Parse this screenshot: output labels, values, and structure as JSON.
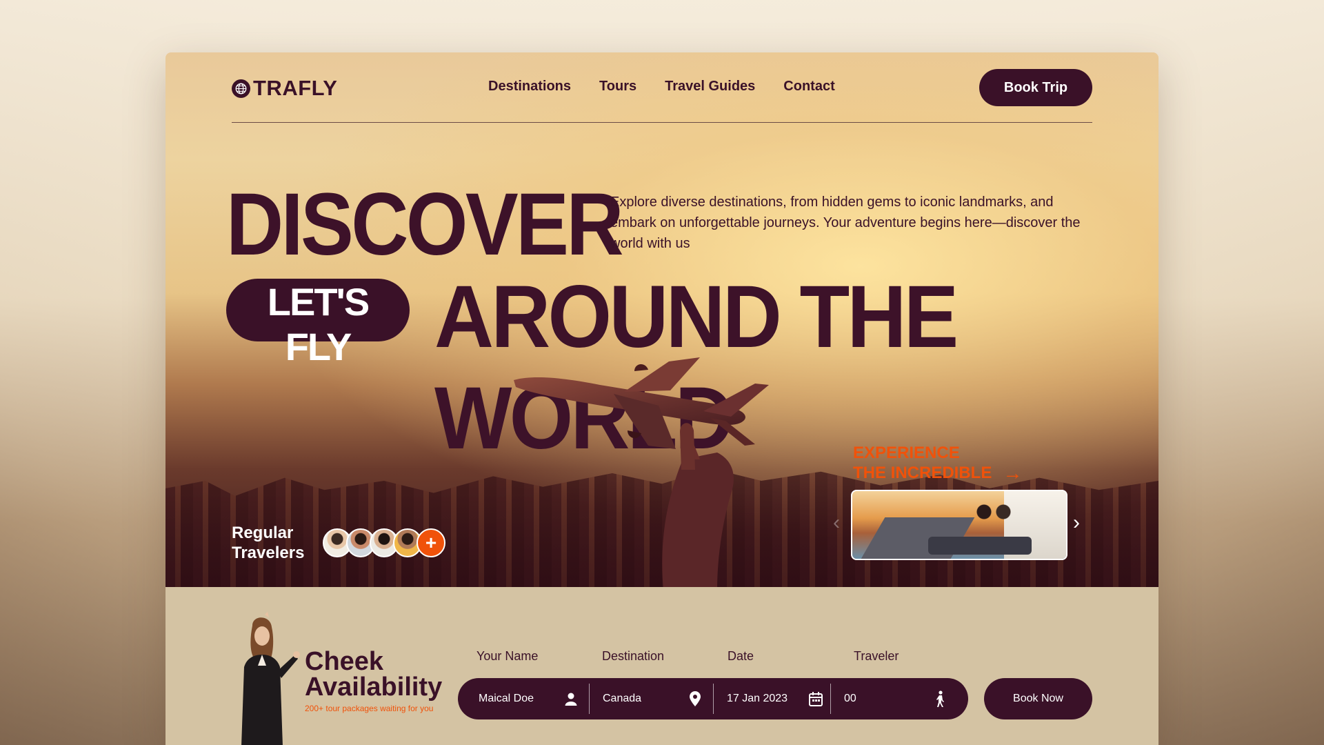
{
  "brand": {
    "name": "TRAFLY"
  },
  "nav": {
    "items": [
      "Destinations",
      "Tours",
      "Travel Guides",
      "Contact"
    ],
    "cta": "Book Trip"
  },
  "hero": {
    "headline_1": "DISCOVER",
    "pill": "LET'S FLY",
    "headline_2": "AROUND THE WORLD",
    "intro": "Explore diverse destinations, from hidden gems to iconic landmarks, and embark on unforgettable journeys. Your adventure begins here—discover the world with us",
    "experience_line1": "EXPERIENCE",
    "experience_line2": "THE INCREDIBLE",
    "regular_line1": "Regular",
    "regular_line2": "Travelers",
    "avatar_more": "+"
  },
  "availability": {
    "title_line1": "Cheek",
    "title_line2": "Availability",
    "subtitle": "200+ tour packages waiting for you",
    "labels": [
      "Your Name",
      "Destination",
      "Date",
      "Traveler"
    ],
    "values": {
      "name": "Maical Doe",
      "destination": "Canada",
      "date": "17 Jan 2023",
      "traveler": "00"
    },
    "button": "Book Now"
  },
  "colors": {
    "primary": "#3a1128",
    "accent": "#f0520a",
    "panel": "#d4c3a3"
  },
  "icons": [
    "globe-icon",
    "arrow-right-icon",
    "chevron-left-icon",
    "chevron-right-icon",
    "user-icon",
    "location-pin-icon",
    "calendar-icon",
    "walking-person-icon"
  ]
}
